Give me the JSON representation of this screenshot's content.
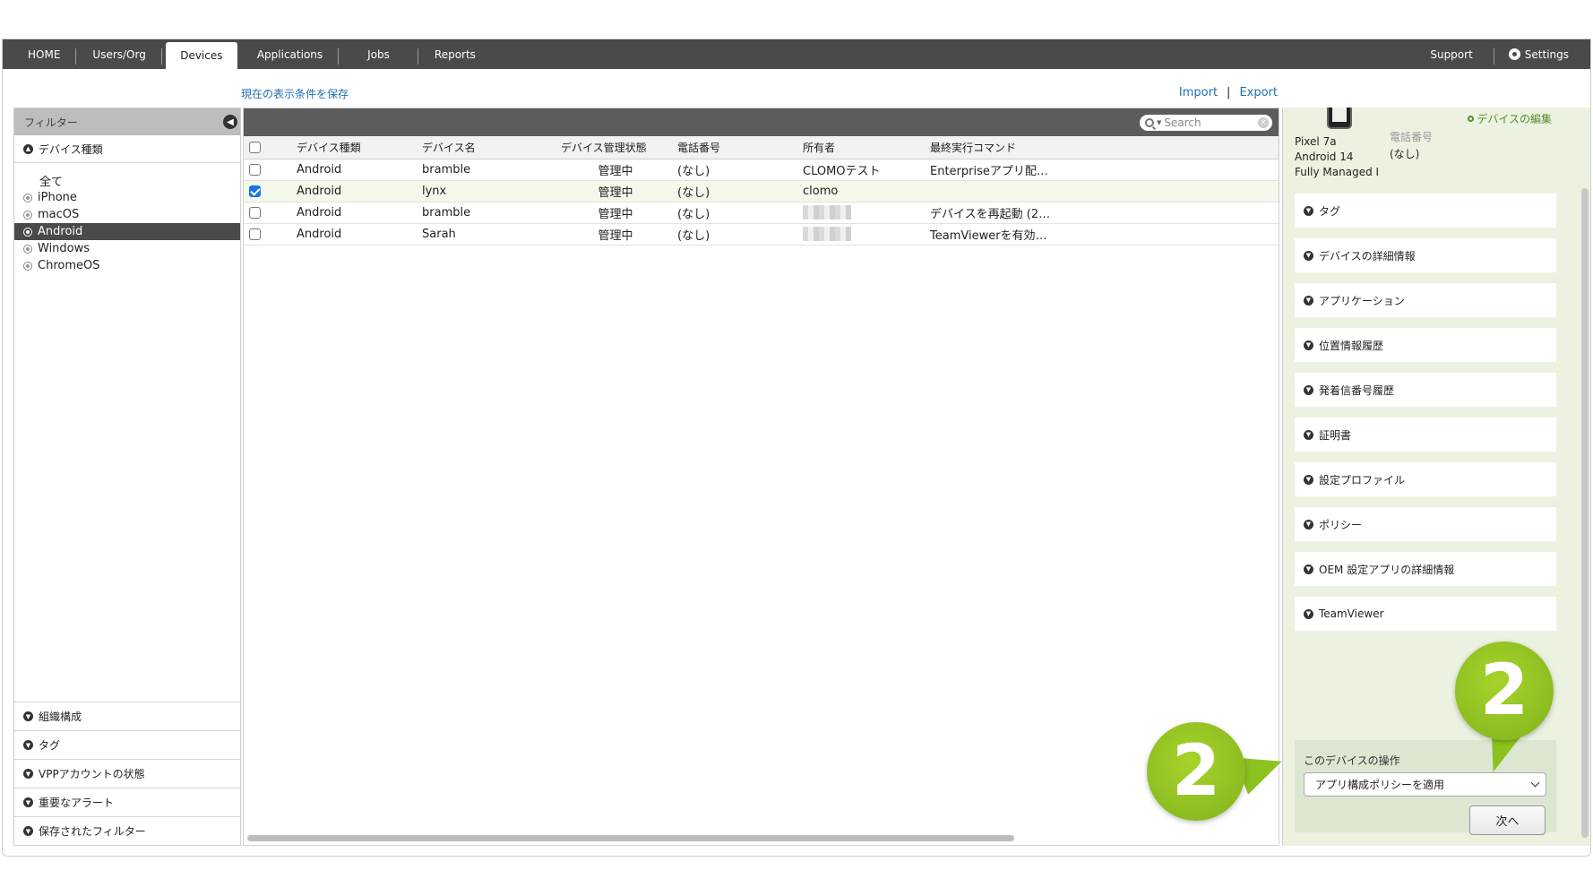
{
  "nav": {
    "tabs": [
      "HOME",
      "Users/Org",
      "Devices",
      "Applications",
      "Jobs",
      "Reports"
    ],
    "active_tab": "Devices",
    "support": "Support",
    "settings": "Settings"
  },
  "links": {
    "save_conditions": "現在の表示条件を保存",
    "import": "Import",
    "separator": "|",
    "export": "Export"
  },
  "filter": {
    "header": "フィルター",
    "device_type_section": "デバイス種類",
    "options": [
      "全て",
      "iPhone",
      "macOS",
      "Android",
      "Windows",
      "ChromeOS"
    ],
    "selected": "Android",
    "bottom_sections": [
      "組織構成",
      "タグ",
      "VPPアカウントの状態",
      "重要なアラート",
      "保存されたフィルター"
    ]
  },
  "grid": {
    "search_placeholder": "Search",
    "columns": [
      "デバイス種類",
      "デバイス名",
      "デバイス管理状態",
      "電話番号",
      "所有者",
      "最終実行コマンド"
    ],
    "rows": [
      {
        "type": "Android",
        "name": "bramble",
        "status": "管理中",
        "phone": "(なし)",
        "owner": "CLOMOテスト",
        "last_command": "Enterpriseアプリ配布…",
        "checked": false,
        "owner_hidden": false
      },
      {
        "type": "Android",
        "name": "lynx",
        "status": "管理中",
        "phone": "(なし)",
        "owner": "clomo",
        "last_command": "",
        "checked": true,
        "owner_hidden": false
      },
      {
        "type": "Android",
        "name": "bramble",
        "status": "管理中",
        "phone": "(なし)",
        "owner": "",
        "last_command": "デバイスを再起動 (202…",
        "checked": false,
        "owner_hidden": true
      },
      {
        "type": "Android",
        "name": "Sarah",
        "status": "管理中",
        "phone": "(なし)",
        "owner": "",
        "last_command": "TeamViewerを有効化 …",
        "checked": false,
        "owner_hidden": true
      }
    ]
  },
  "detail": {
    "edit_link": "デバイスの編集",
    "model": "Pixel 7a",
    "os": "Android 14",
    "mode": "Fully Managed I",
    "phone_label": "電話番号",
    "phone_value": "(なし)",
    "sections": [
      "タグ",
      "デバイスの詳細情報",
      "アプリケーション",
      "位置情報履歴",
      "発着信番号履歴",
      "証明書",
      "設定プロファイル",
      "ポリシー",
      "OEM 設定アプリの詳細情報",
      "TeamViewer"
    ],
    "operations_title": "このデバイスの操作",
    "operation_selected": "アプリ構成ポリシーを適用",
    "next_button": "次へ"
  },
  "callouts": {
    "step_number": "2"
  },
  "colors": {
    "nav_bg": "#4a4a4a",
    "link_blue": "#1f6eb3",
    "panel_green": "#ebf2e0",
    "badge_green": "#8cc21f"
  }
}
